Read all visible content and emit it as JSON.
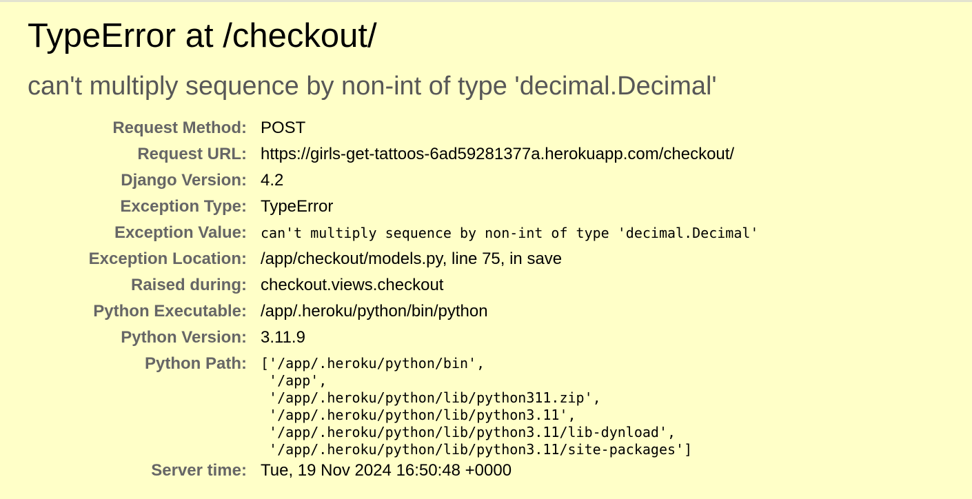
{
  "title": "TypeError at /checkout/",
  "exception_message": "can't multiply sequence by non-int of type 'decimal.Decimal'",
  "meta": {
    "request_method": {
      "label": "Request Method:",
      "value": "POST"
    },
    "request_url": {
      "label": "Request URL:",
      "value": "https://girls-get-tattoos-6ad59281377a.herokuapp.com/checkout/"
    },
    "django_version": {
      "label": "Django Version:",
      "value": "4.2"
    },
    "exception_type": {
      "label": "Exception Type:",
      "value": "TypeError"
    },
    "exception_value": {
      "label": "Exception Value:",
      "value": "can't multiply sequence by non-int of type 'decimal.Decimal'"
    },
    "exception_location": {
      "label": "Exception Location:",
      "value": "/app/checkout/models.py, line 75, in save"
    },
    "raised_during": {
      "label": "Raised during:",
      "value": "checkout.views.checkout"
    },
    "python_executable": {
      "label": "Python Executable:",
      "value": "/app/.heroku/python/bin/python"
    },
    "python_version": {
      "label": "Python Version:",
      "value": "3.11.9"
    },
    "python_path": {
      "label": "Python Path:",
      "value": "['/app/.heroku/python/bin',\n '/app',\n '/app/.heroku/python/lib/python311.zip',\n '/app/.heroku/python/lib/python3.11',\n '/app/.heroku/python/lib/python3.11/lib-dynload',\n '/app/.heroku/python/lib/python3.11/site-packages']"
    },
    "server_time": {
      "label": "Server time:",
      "value": "Tue, 19 Nov 2024 16:50:48 +0000"
    }
  },
  "colors": {
    "background": "#ffffc8",
    "label": "#666666",
    "subtitle": "#575757"
  }
}
